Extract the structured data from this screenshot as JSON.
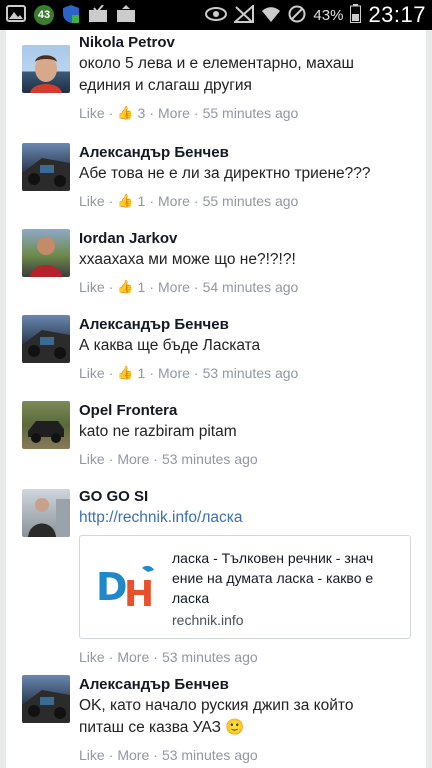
{
  "status_bar": {
    "notification_count": "43",
    "battery": "43%",
    "time": "23:17",
    "icons": [
      "image-icon",
      "notification-badge",
      "shield-icon",
      "mail-check-icon",
      "photo-upload-icon",
      "eye-icon",
      "no-signal-icon",
      "wifi-icon",
      "do-not-disturb-icon",
      "battery-icon"
    ]
  },
  "comments": [
    {
      "author": "Nikola Petrov",
      "lines": [
        "около 5 лева и е елементарно, махаш",
        "единия и слагаш другия"
      ],
      "like": "Like",
      "like_count": "3",
      "more": "More",
      "time": "55 minutes ago"
    },
    {
      "author": "Александър Бенчев",
      "lines": [
        "Абе това не е ли за директно триене???"
      ],
      "like": "Like",
      "like_count": "1",
      "more": "More",
      "time": "55 minutes ago"
    },
    {
      "author": "Iordan Jarkov",
      "lines": [
        "ххаахаха ми може що не?!?!?!"
      ],
      "like": "Like",
      "like_count": "1",
      "more": "More",
      "time": "54 minutes ago"
    },
    {
      "author": "Александър Бенчев",
      "lines": [
        "А каква ще бъде Ласката"
      ],
      "like": "Like",
      "like_count": "1",
      "more": "More",
      "time": "53 minutes ago"
    },
    {
      "author": "Opel Frontera",
      "lines": [
        "kato ne razbiram pitam"
      ],
      "like": "Like",
      "like_count": "",
      "more": "More",
      "time": "53 minutes ago"
    },
    {
      "author": "GO GO SI",
      "link_text": "http://rechnik.info/ласка",
      "card": {
        "title_lines": [
          "ласка - Тълковен речник - знач",
          "ение на думата ласка - какво е",
          "ласка"
        ],
        "domain": "rechnik.info",
        "logo": "DH"
      },
      "like": "Like",
      "like_count": "",
      "more": "More",
      "time": "53 minutes ago"
    },
    {
      "author": "Александър Бенчев",
      "lines": [
        "OK, като начало руския джип за който",
        "питаш се казва УАЗ 🙂"
      ],
      "like": "Like",
      "like_count": "",
      "more": "More",
      "time": "53 minutes ago"
    }
  ]
}
